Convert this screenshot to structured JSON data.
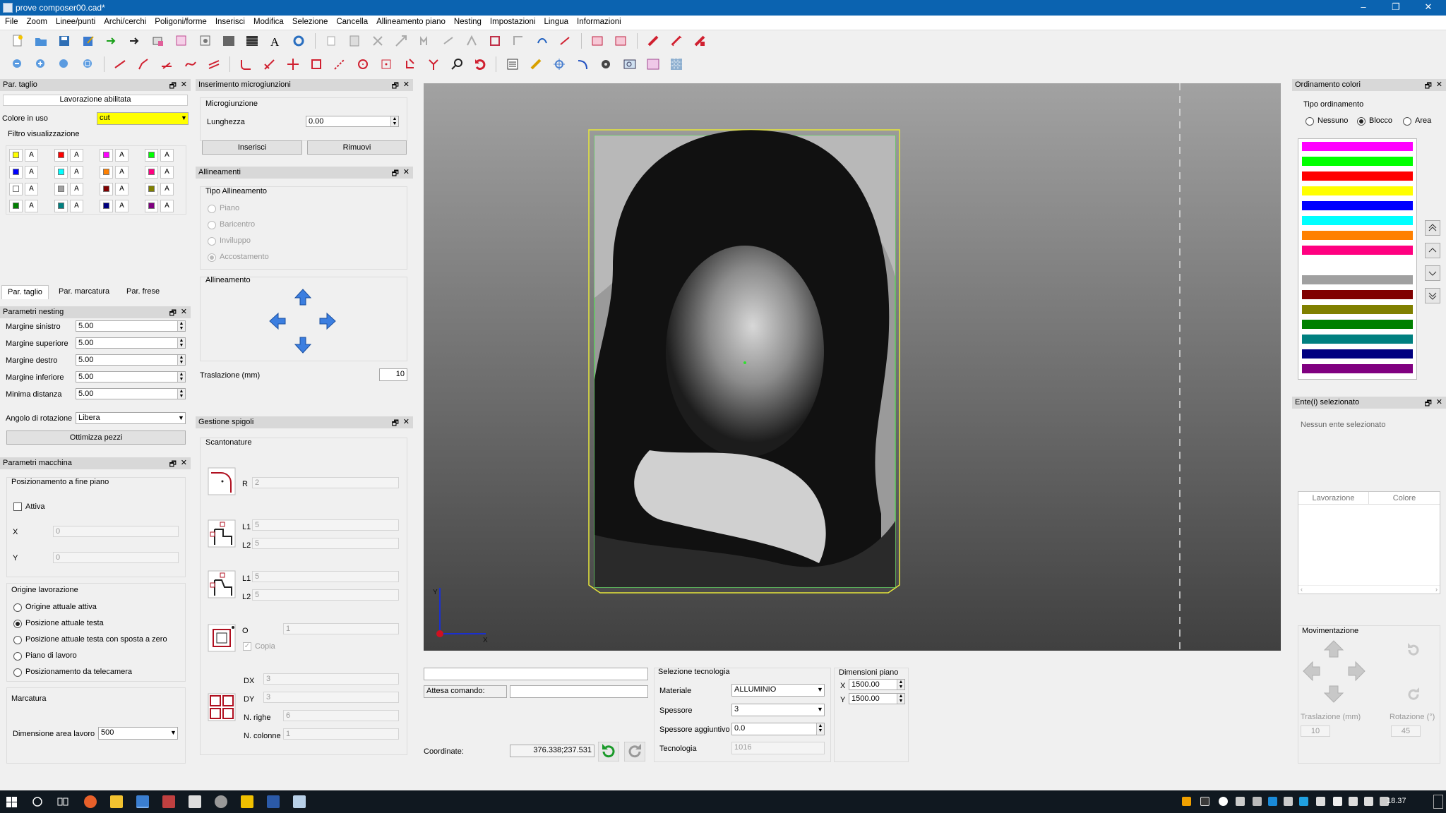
{
  "window": {
    "title": "prove composer00.cad*",
    "controls": {
      "minimize": "–",
      "maximize": "❐",
      "close": "✕"
    }
  },
  "menu": [
    "File",
    "Zoom",
    "Linee/punti",
    "Archi/cerchi",
    "Poligoni/forme",
    "Inserisci",
    "Modifica",
    "Selezione",
    "Cancella",
    "Allineamento piano",
    "Nesting",
    "Impostazioni",
    "Lingua",
    "Informazioni"
  ],
  "par_taglio": {
    "title": "Par. taglio",
    "status": "Lavorazione abilitata",
    "colore_label": "Colore in uso",
    "colore_value": "cut",
    "colore_hex": "#ffff00",
    "filtro_label": "Filtro visualizzazione",
    "swatch_letter": "A",
    "swatches": [
      "#ffff00",
      "#ff0000",
      "#ff00ff",
      "#00ff00",
      "#0000ff",
      "#00ffff",
      "#ff8000",
      "#ff0080",
      "#ffffff",
      "#a0a0a0",
      "#800000",
      "#808000",
      "#008000",
      "#008080",
      "#000080",
      "#800080"
    ],
    "tabs": [
      "Par. taglio",
      "Par. marcatura",
      "Par. frese"
    ]
  },
  "nesting": {
    "title": "Parametri nesting",
    "fields": [
      {
        "label": "Margine sinistro",
        "value": "5.00"
      },
      {
        "label": "Margine superiore",
        "value": "5.00"
      },
      {
        "label": "Margine destro",
        "value": "5.00"
      },
      {
        "label": "Margine inferiore",
        "value": "5.00"
      },
      {
        "label": "Minima distanza",
        "value": "5.00"
      }
    ],
    "rot_label": "Angolo di rotazione",
    "rot_value": "Libera",
    "button": "Ottimizza pezzi"
  },
  "macchina": {
    "title": "Parametri macchina",
    "pos_group": "Posizionamento a fine piano",
    "attiva": "Attiva",
    "x_label": "X",
    "x_value": "0",
    "y_label": "Y",
    "y_value": "0",
    "origine_group": "Origine lavorazione",
    "origine_options": [
      "Origine attuale attiva",
      "Posizione attuale testa",
      "Posizione attuale testa con sposta a zero",
      "Piano di lavoro",
      "Posizionamento da telecamera"
    ],
    "origine_selected": 1,
    "marcatura_group": "Marcatura",
    "dim_label": "Dimensione area lavoro",
    "dim_value": "500"
  },
  "micro": {
    "title": "Inserimento microgiunzioni",
    "group": "Microgiunzione",
    "lunghezza_label": "Lunghezza",
    "lunghezza_value": "0.00",
    "inserisci": "Inserisci",
    "rimuovi": "Rimuovi"
  },
  "allineamenti": {
    "title": "Allineamenti",
    "tipo_group": "Tipo Allineamento",
    "tipo_options": [
      "Piano",
      "Baricentro",
      "Inviluppo",
      "Accostamento"
    ],
    "tipo_selected": 3,
    "allineamento_group": "Allineamento",
    "traslazione_label": "Traslazione (mm)",
    "traslazione_value": "10"
  },
  "spigoli": {
    "title": "Gestione spigoli",
    "group": "Scantonature",
    "r_label": "R",
    "r_value": "2",
    "l1_label": "L1",
    "l2_label": "L2",
    "l1a": "5",
    "l2a": "5",
    "l1b": "5",
    "l2b": "5",
    "o_label": "O",
    "o_value": "1",
    "copia": "Copia",
    "dx_label": "DX",
    "dx_value": "3",
    "dy_label": "DY",
    "dy_value": "3",
    "righe_label": "N. righe",
    "righe_value": "6",
    "colonne_label": "N. colonne",
    "colonne_value": "1"
  },
  "canvas": {
    "axis_x": "X",
    "axis_y": "Y"
  },
  "command": {
    "attesa_label": "Attesa comando:",
    "coordinate_label": "Coordinate:",
    "coordinate_value": "376.338;237.531"
  },
  "tecnologia": {
    "title": "Selezione tecnologia",
    "materiale_label": "Materiale",
    "materiale_value": "ALLUMINIO",
    "spessore_label": "Spessore",
    "spessore_value": "3",
    "spessore_agg_label": "Spessore aggiuntivo",
    "spessore_agg_value": "0.0",
    "tecnologia_label": "Tecnologia",
    "tecnologia_value": "1016"
  },
  "dimensioni": {
    "title": "Dimensioni piano",
    "x_label": "X",
    "x_value": "1500.00",
    "y_label": "Y",
    "y_value": "1500.00"
  },
  "ordinamento": {
    "title": "Ordinamento colori",
    "tipo_label": "Tipo ordinamento",
    "options": [
      "Nessuno",
      "Blocco",
      "Area"
    ],
    "selected": 1,
    "colors": [
      "#ff00ff",
      "#00ff00",
      "#ff0000",
      "#ffff00",
      "#0000ff",
      "#00ffff",
      "#ff8000",
      "#ff0080",
      "#ffffff",
      "#a0a0a0",
      "#800000",
      "#808000",
      "#008000",
      "#008080",
      "#000080",
      "#800080"
    ]
  },
  "enti": {
    "title": "Ente(i) selezionato",
    "empty": "Nessun ente selezionato",
    "col_lavorazione": "Lavorazione",
    "col_colore": "Colore"
  },
  "movimentazione": {
    "title": "Movimentazione",
    "traslazione_label": "Traslazione (mm)",
    "traslazione_value": "10",
    "rotazione_label": "Rotazione (°)",
    "rotazione_value": "45"
  },
  "taskbar": {
    "clock": "18.37"
  }
}
